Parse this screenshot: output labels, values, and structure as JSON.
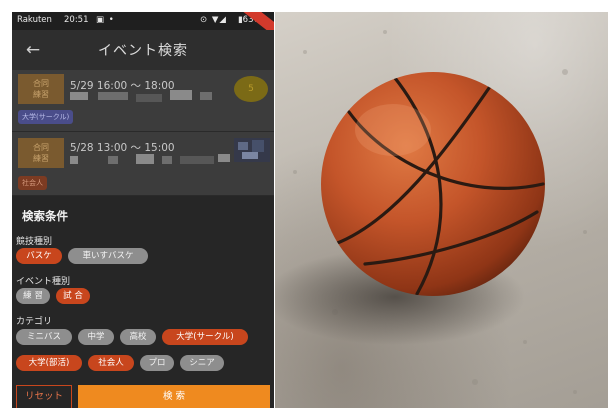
{
  "status_bar": {
    "carrier": "Rakuten",
    "time": "20:51",
    "left_icons": "▣ •",
    "right_icons": "⊙ ▼◢",
    "battery": "▮63%"
  },
  "app_bar": {
    "title": "イベント検索",
    "back_icon": "←"
  },
  "events": [
    {
      "badge_line1": "合同",
      "badge_line2": "練習",
      "time": "5/29 16:00 〜 18:00",
      "tag": "大学(サークル)",
      "count": "5"
    },
    {
      "badge_line1": "合同",
      "badge_line2": "練習",
      "time": "5/28 13:00 〜 15:00",
      "tag": "社会人"
    }
  ],
  "search_panel": {
    "title": "検索条件",
    "sports": {
      "label": "競技種別",
      "options": [
        {
          "label": "バスケ",
          "selected": true
        },
        {
          "label": "車いすバスケ",
          "selected": false
        }
      ]
    },
    "event_types": {
      "label": "イベント種別",
      "options": [
        {
          "label": "練 習",
          "selected": false
        },
        {
          "label": "試 合",
          "selected": true
        }
      ]
    },
    "categories": {
      "label": "カテゴリ",
      "options": [
        {
          "label": "ミニバス",
          "selected": false
        },
        {
          "label": "中学",
          "selected": false
        },
        {
          "label": "高校",
          "selected": false
        },
        {
          "label": "大学(サークル)",
          "selected": true
        },
        {
          "label": "大学(部活)",
          "selected": true
        },
        {
          "label": "社会人",
          "selected": true
        },
        {
          "label": "プロ",
          "selected": false
        },
        {
          "label": "シニア",
          "selected": false
        }
      ]
    },
    "reset_label": "リセット",
    "search_label": "検 索"
  },
  "colors": {
    "accent_orange": "#ef8a1f",
    "chip_selected": "#c8461d",
    "chip_unselected": "#8e8e8e",
    "panel_bg": "#262626"
  },
  "photo": {
    "subject_icon": "basketball-icon"
  }
}
